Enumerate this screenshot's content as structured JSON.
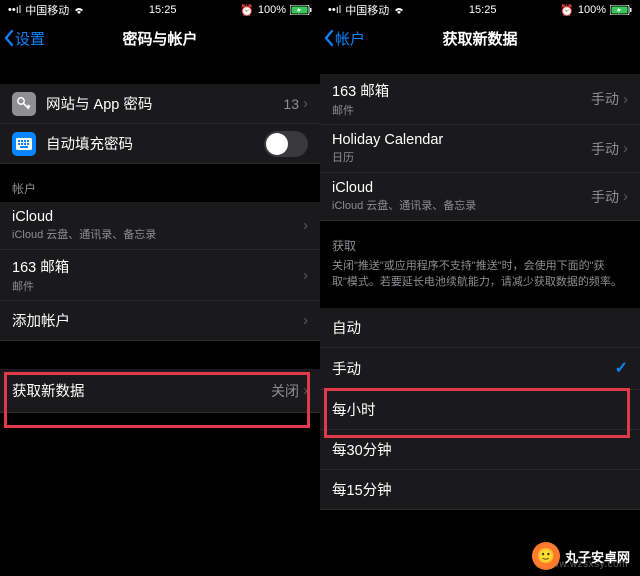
{
  "statusbar": {
    "carrier": "中国移动",
    "time": "15:25",
    "battery": "100%"
  },
  "left": {
    "nav_back": "设置",
    "nav_title": "密码与帐户",
    "row_passwords": {
      "label": "网站与 App 密码",
      "value": "13"
    },
    "row_autofill": {
      "label": "自动填充密码"
    },
    "section_accounts": "帐户",
    "row_icloud": {
      "label": "iCloud",
      "sub": "iCloud 云盘、通讯录、备忘录"
    },
    "row_163": {
      "label": "163 邮箱",
      "sub": "邮件"
    },
    "row_add": {
      "label": "添加帐户"
    },
    "row_fetch": {
      "label": "获取新数据",
      "value": "关闭"
    }
  },
  "right": {
    "nav_back": "帐户",
    "nav_title": "获取新数据",
    "row_163": {
      "label": "163 邮箱",
      "sub": "邮件",
      "value": "手动"
    },
    "row_holiday": {
      "label": "Holiday Calendar",
      "sub": "日历",
      "value": "手动"
    },
    "row_icloud": {
      "label": "iCloud",
      "sub": "iCloud 云盘、通讯录、备忘录",
      "value": "手动"
    },
    "section_fetch": "获取",
    "footer_text": "关闭\"推送\"或应用程序不支持\"推送\"时，会使用下面的\"获取\"模式。若要延长电池续航能力，请减少获取数据的频率。",
    "opt_auto": "自动",
    "opt_manual": "手动",
    "opt_hourly": "每小时",
    "opt_30min": "每30分钟",
    "opt_15min": "每15分钟"
  },
  "watermark": {
    "brand": "丸子安卓网",
    "url": "www.wzsxsy.com"
  }
}
